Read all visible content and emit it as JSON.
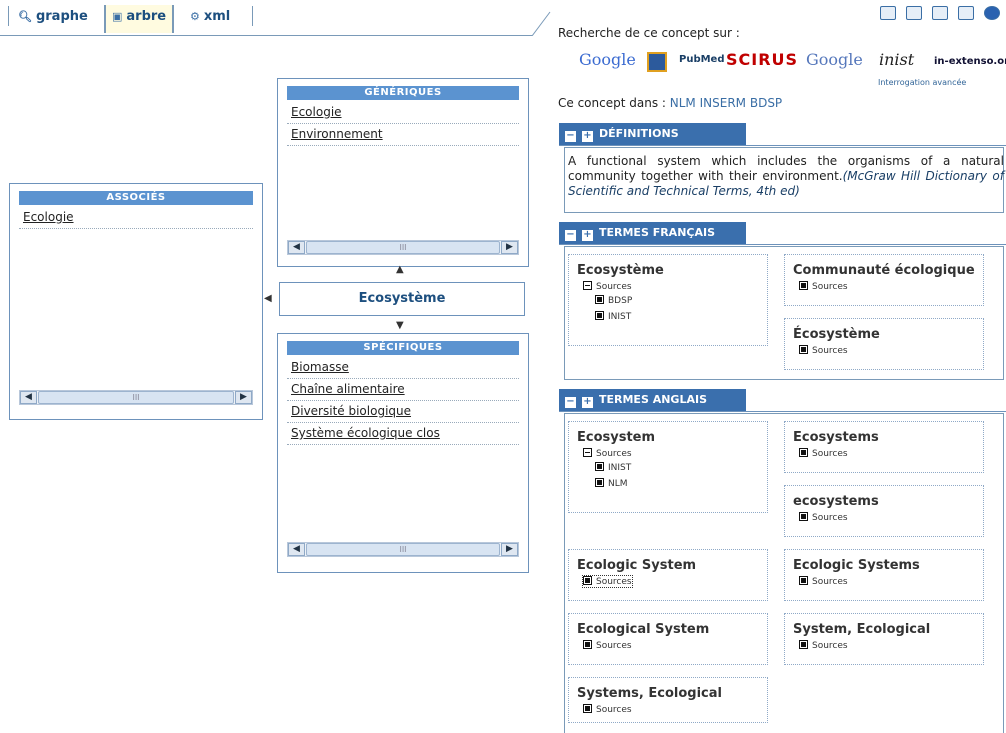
{
  "tabs": [
    {
      "label": "graphe",
      "icon": "magnifier-icon"
    },
    {
      "label": "arbre",
      "icon": "tree-icon"
    },
    {
      "label": "xml",
      "icon": "xml-icon"
    }
  ],
  "graph": {
    "generiques": {
      "title": "GÉNÉRIQUES",
      "items": [
        "Ecologie",
        "Environnement"
      ]
    },
    "associes": {
      "title": "ASSOCIÉS",
      "items": [
        "Ecologie"
      ]
    },
    "specifiques": {
      "title": "SPÉCIFIQUES",
      "items": [
        "Biomasse",
        "Chaîne alimentaire",
        "Diversité biologique",
        "Système écologique clos"
      ]
    },
    "center": "Ecosystème",
    "scroll_thumb": "III"
  },
  "search": {
    "title": "Recherche de ce concept sur :",
    "engines": [
      "Google",
      "PubMed",
      "SCIRUS",
      "Google",
      "inist",
      "in-extenso.org"
    ],
    "advanced": "Interrogation avancée"
  },
  "concept_in": {
    "label": "Ce concept dans :",
    "links": [
      "NLM",
      "INSERM",
      "BDSP"
    ]
  },
  "definitions": {
    "header": "DÉFINITIONS",
    "text": "A functional system which includes the organisms of a natural community together with their environment.",
    "source": "(McGraw Hill Dictionary of Scientific and Technical Terms, 4th ed)"
  },
  "termes_francais": {
    "header": "TERMES FRANÇAIS",
    "sources_label": "Sources",
    "terms": [
      {
        "name": "Ecosystème",
        "expanded": true,
        "subs": [
          "BDSP",
          "INIST"
        ]
      },
      {
        "name": "Communauté écologique",
        "expanded": false,
        "subs": []
      },
      {
        "name": "Écosystème",
        "expanded": false,
        "subs": []
      }
    ]
  },
  "termes_anglais": {
    "header": "TERMES ANGLAIS",
    "sources_label": "Sources",
    "terms": [
      {
        "name": "Ecosystem",
        "expanded": true,
        "subs": [
          "INIST",
          "NLM"
        ]
      },
      {
        "name": "Ecosystems",
        "expanded": false,
        "subs": []
      },
      {
        "name": "ecosystems",
        "expanded": false,
        "subs": []
      },
      {
        "name": "Ecologic System",
        "expanded": false,
        "subs": []
      },
      {
        "name": "Ecologic Systems",
        "expanded": false,
        "subs": []
      },
      {
        "name": "Ecological System",
        "expanded": false,
        "subs": []
      },
      {
        "name": "System, Ecological",
        "expanded": false,
        "subs": []
      },
      {
        "name": "Systems, Ecological",
        "expanded": false,
        "subs": []
      }
    ]
  },
  "colors": {
    "accent": "#3a6fad",
    "header_blue": "#5b93d0",
    "link": "#3a6ea5"
  }
}
